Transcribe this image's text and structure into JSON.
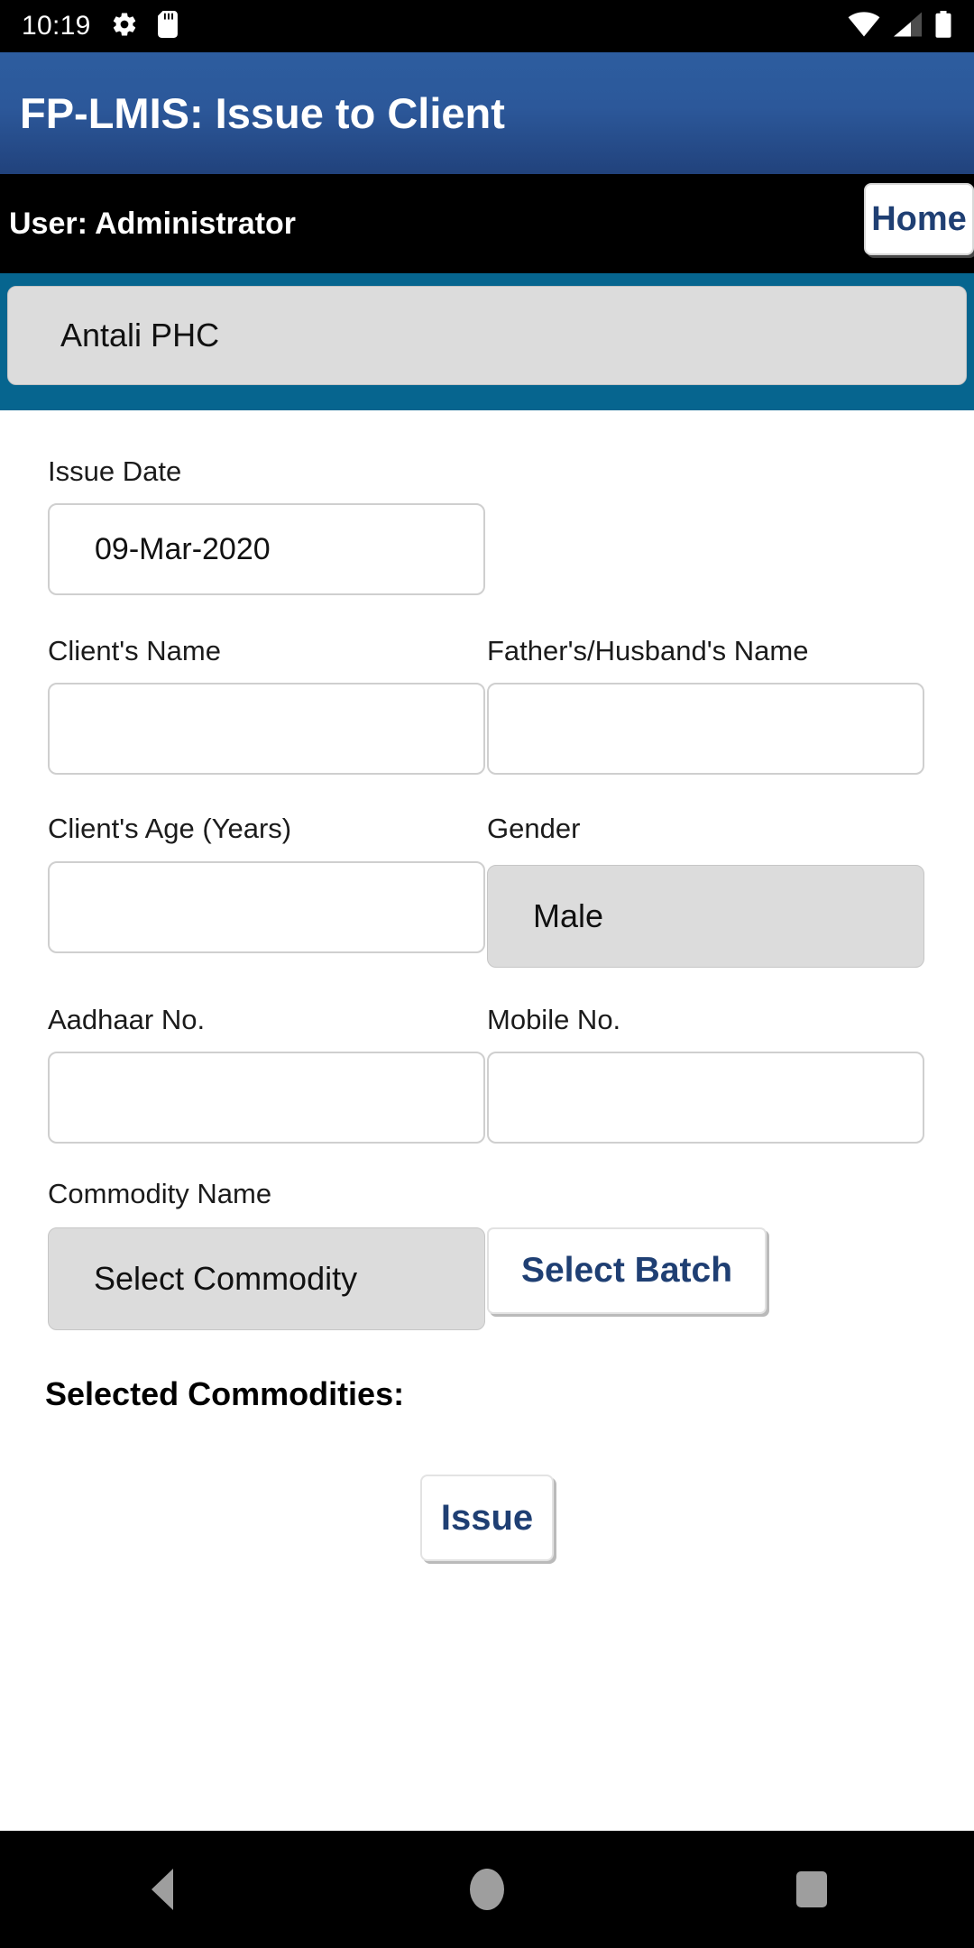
{
  "status_bar": {
    "time": "10:19",
    "icons_left": [
      "gear-icon",
      "sd-card-icon"
    ],
    "icons_right": [
      "wifi-icon",
      "signal-icon",
      "battery-icon"
    ]
  },
  "title_bar": {
    "title": "FP-LMIS: Issue to Client",
    "background_color": "#2c589a"
  },
  "user_bar": {
    "user_text": "User: Administrator",
    "home_label": "Home",
    "accent_color": "#1f3f73"
  },
  "facility": {
    "selected": "Antali PHC",
    "band_color": "#06658f"
  },
  "form": {
    "issue_date": {
      "label": "Issue Date",
      "value": "09-Mar-2020"
    },
    "clients_name": {
      "label": "Client's Name",
      "value": "",
      "placeholder": ""
    },
    "fathers_husbands_name": {
      "label": "Father's/Husband's Name",
      "value": "",
      "placeholder": ""
    },
    "clients_age": {
      "label": "Client's Age (Years)",
      "value": "",
      "placeholder": ""
    },
    "gender": {
      "label": "Gender",
      "value": "Male"
    },
    "aadhaar_no": {
      "label": "Aadhaar No.",
      "value": "",
      "placeholder": ""
    },
    "mobile_no": {
      "label": "Mobile No.",
      "value": "",
      "placeholder": ""
    },
    "commodity_name": {
      "label": "Commodity Name",
      "value": "Select Commodity"
    },
    "select_batch_label": "Select Batch",
    "selected_commodities_heading": "Selected Commodities:",
    "issue_label": "Issue"
  },
  "nav_bar": {
    "back": "back-icon",
    "home": "home-icon",
    "recents": "recents-icon"
  }
}
